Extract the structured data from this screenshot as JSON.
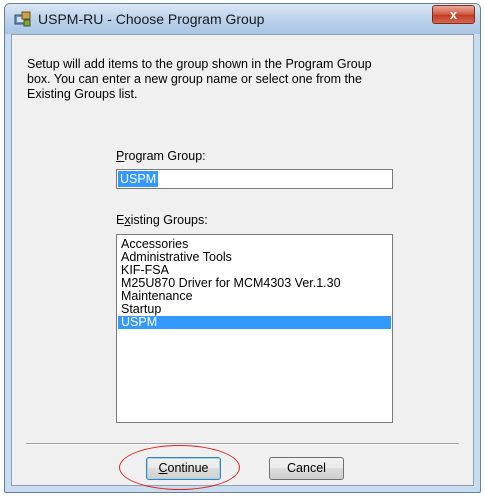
{
  "window": {
    "title": "USPM-RU - Choose Program Group",
    "close_glyph": "x"
  },
  "description": "Setup will add items to the group shown in the Program Group\nbox. You can enter a new group name or select one from the\nExisting Groups list.",
  "program_group": {
    "label_mnemonic": "P",
    "label_rest": "rogram Group:",
    "value": "USPM"
  },
  "existing_groups": {
    "label_mnemonic": "x",
    "label_prefix": "E",
    "label_rest": "isting Groups:",
    "items": [
      "Accessories",
      "Administrative Tools",
      "KIF-FSA",
      "M25U870 Driver for MCM4303 Ver.1.30",
      "Maintenance",
      "Startup",
      "USPM"
    ],
    "selected": "USPM"
  },
  "buttons": {
    "continue_mnemonic": "C",
    "continue_rest": "ontinue",
    "cancel_label": "Cancel"
  },
  "colors": {
    "selection": "#3399ff",
    "annotation": "#e0231c"
  }
}
